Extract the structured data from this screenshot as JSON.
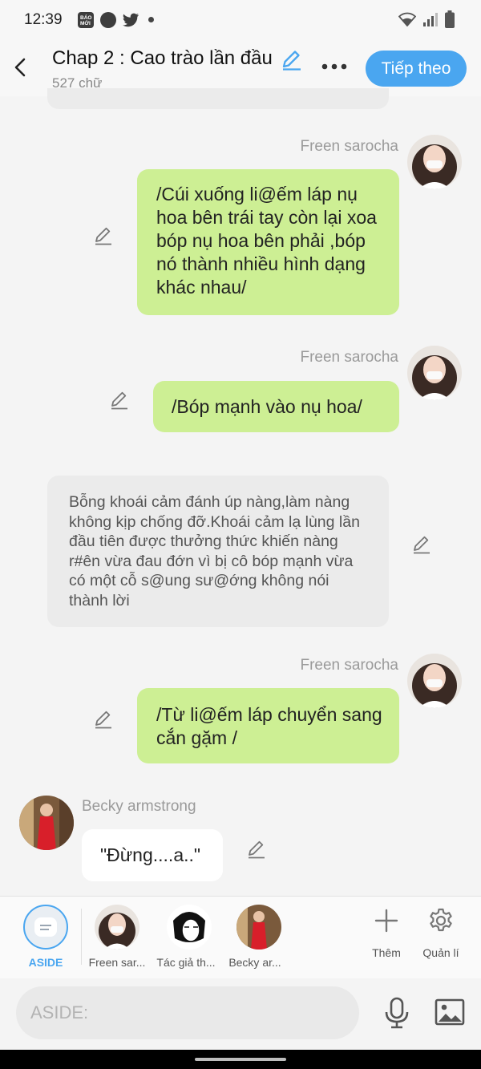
{
  "status_bar": {
    "time": "12:39",
    "left_icons": [
      "baomoi-app-icon",
      "compass-app-icon",
      "twitter-icon",
      "dot-icon"
    ],
    "right_icons": [
      "wifi-icon",
      "signal-icon",
      "battery-icon"
    ]
  },
  "header": {
    "title": "Chap 2 : Cao trào lần đầu",
    "word_count": "527 chữ",
    "next_label": "Tiếp theo",
    "accent": "#4aa6f0"
  },
  "messages": [
    {
      "sender": "Freen sarocha",
      "side": "right",
      "text": "/Cúi xuống li@ếm láp nụ hoa bên trái tay còn lại xoa bóp nụ hoa bên phải ,bóp nó thành nhiều hình dạng khác nhau/"
    },
    {
      "sender": "Freen sarocha",
      "side": "right",
      "text": "/Bóp mạnh vào nụ hoa/"
    },
    {
      "sender": "",
      "side": "narration",
      "text": "Bỗng khoái cảm đánh úp nàng,làm nàng không kịp chống đỡ.Khoái cảm lạ lùng lần đầu tiên được thưởng thức khiến nàng r#ên vừa đau đớn vì bị cô bóp mạnh vừa có một cỗ s@ung sư@ớng không nói thành lời"
    },
    {
      "sender": "Freen sarocha",
      "side": "right",
      "text": "/Từ li@ếm láp chuyển sang cắn gặm /"
    },
    {
      "sender": "Becky armstrong",
      "side": "left",
      "text": "\"Đừng....a..\""
    }
  ],
  "characters": [
    {
      "label": "ASIDE",
      "selected": true
    },
    {
      "label": "Freen sar...",
      "selected": false
    },
    {
      "label": "Tác giả th...",
      "selected": false
    },
    {
      "label": "Becky ar...",
      "selected": false
    }
  ],
  "actions": {
    "add_label": "Thêm",
    "manage_label": "Quản lí"
  },
  "input": {
    "placeholder": "ASIDE:"
  },
  "colors": {
    "green_bubble": "#cdef94",
    "gray_bubble": "#ebebeb",
    "selected_label": "#4aa6f0"
  }
}
